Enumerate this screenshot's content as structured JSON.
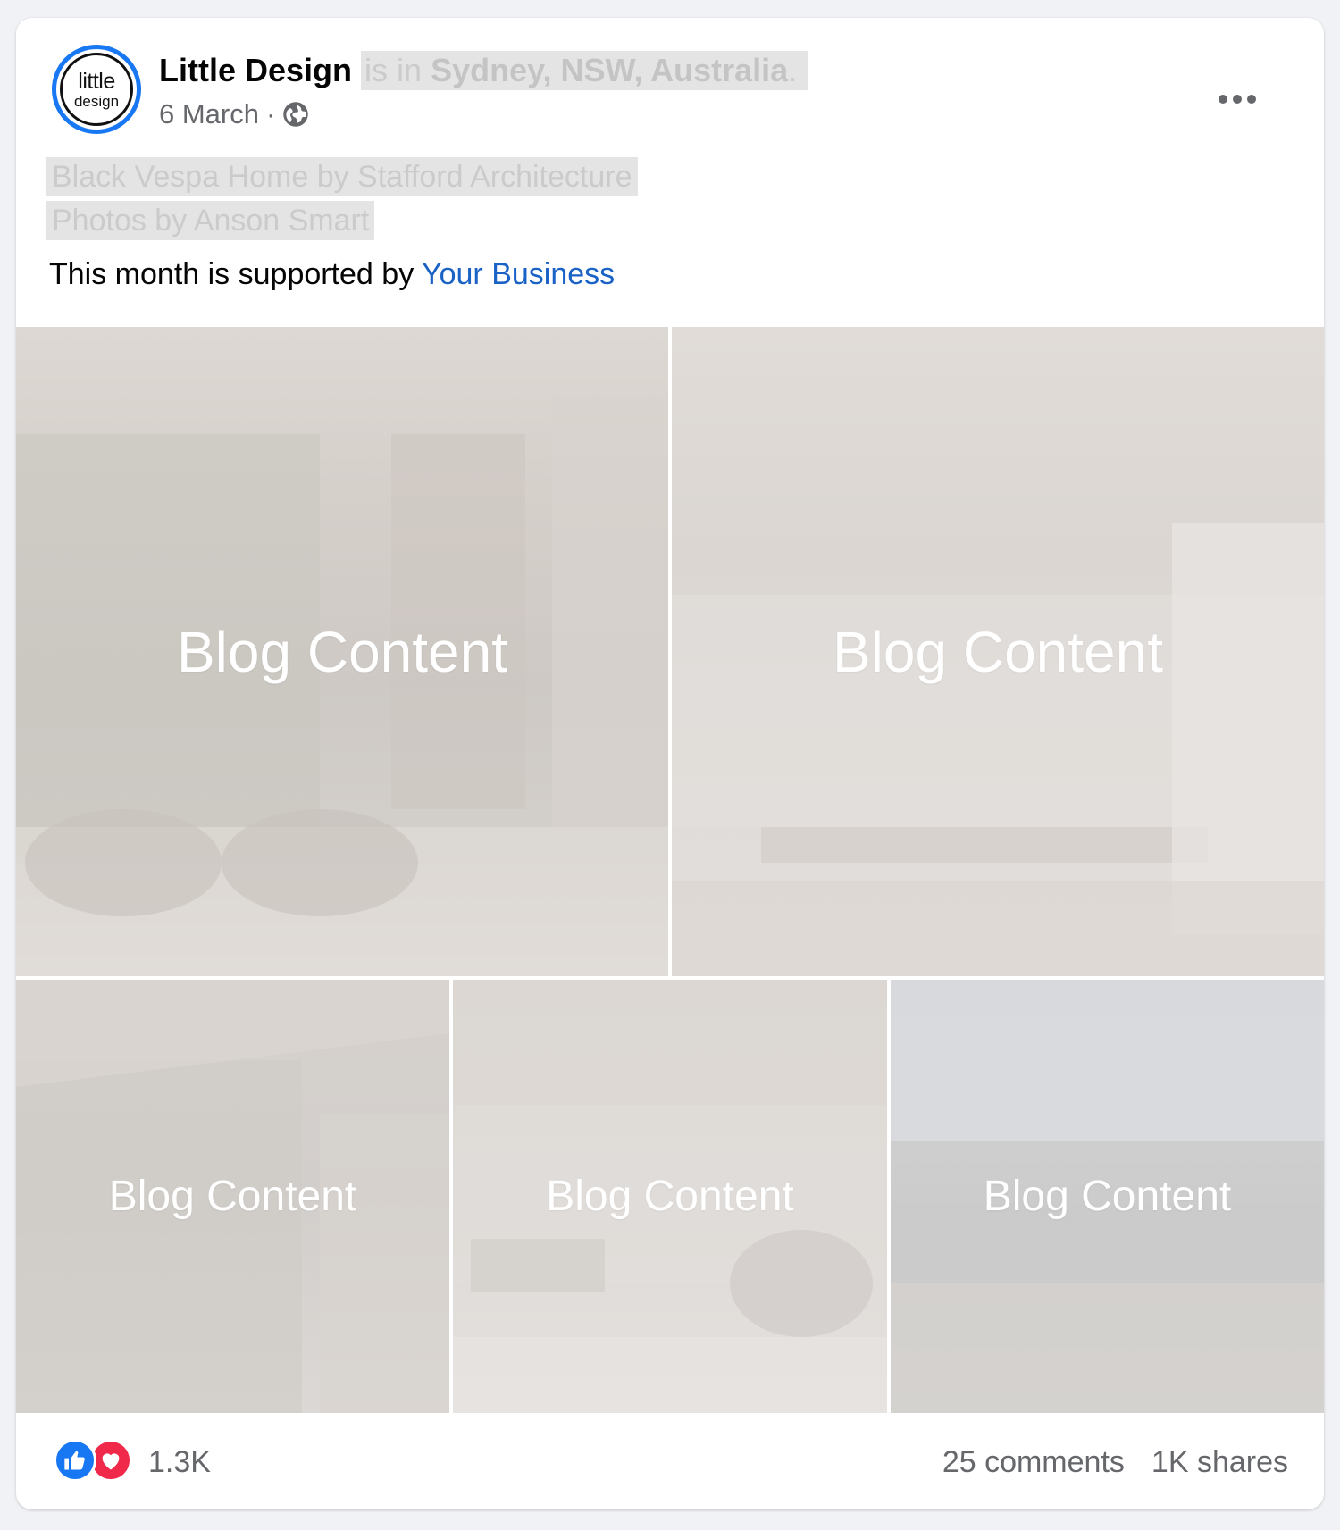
{
  "post": {
    "page_name": "Little Design",
    "location_prefix": "is in",
    "location": "Sydney, NSW, Australia",
    "location_suffix": ".",
    "date": "6 March",
    "separator": "·",
    "avatar": {
      "logo_top": "little",
      "logo_bottom": "design"
    },
    "caption_lines": [
      "Black Vespa Home by Stafford Architecture",
      "Photos by Anson Smart"
    ],
    "support_text": "This month is supported by",
    "support_link": "Your Business"
  },
  "photos": [
    {
      "label": "Blog Content"
    },
    {
      "label": "Blog Content"
    },
    {
      "label": "Blog Content"
    },
    {
      "label": "Blog Content"
    },
    {
      "label": "Blog Content"
    }
  ],
  "footer": {
    "reaction_count": "1.3K",
    "comments": "25 comments",
    "shares": "1K shares",
    "reactions": [
      "like-icon",
      "love-icon"
    ]
  },
  "colors": {
    "accent": "#1877f2",
    "link": "#1a62c6",
    "love": "#f0284a",
    "muted": "#65676b"
  },
  "icons": [
    "globe-icon",
    "more-options-icon"
  ]
}
